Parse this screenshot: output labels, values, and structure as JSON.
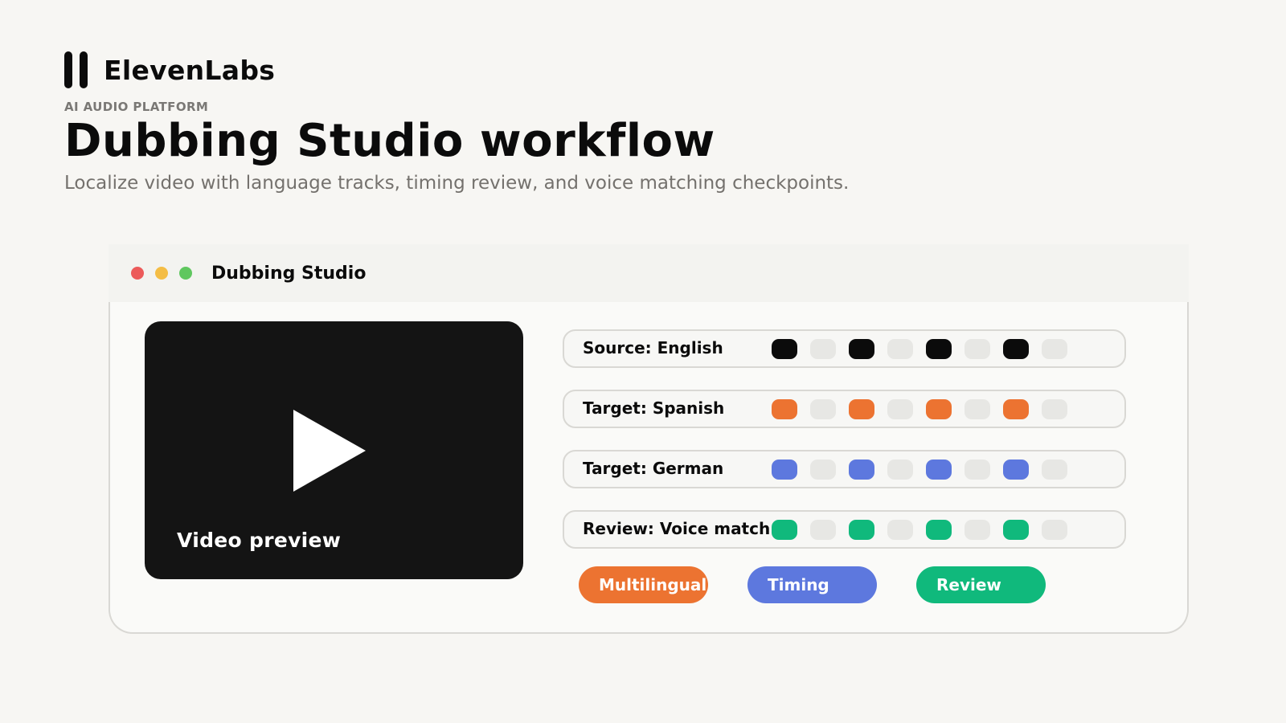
{
  "brand": {
    "name": "ElevenLabs",
    "eyebrow": "AI AUDIO PLATFORM"
  },
  "page": {
    "title": "Dubbing Studio workflow",
    "subtitle": "Localize video with language tracks, timing review, and voice matching checkpoints."
  },
  "colors": {
    "background": "#f7f6f3",
    "close": "#ec5a5a",
    "minimize": "#f4bd45",
    "maximize": "#5fc75f",
    "source": "#0b0b0b",
    "spanish": "#ec7331",
    "german": "#5d78de",
    "review": "#10b97c",
    "empty_block": "#e7e7e4"
  },
  "window": {
    "title": "Dubbing Studio",
    "controls": [
      "close-icon",
      "minimize-icon",
      "maximize-icon"
    ]
  },
  "video": {
    "label": "Video preview",
    "icon": "play-icon"
  },
  "tracks": [
    {
      "label": "Source: English",
      "color": "#0b0b0b",
      "blocks": [
        1,
        0,
        1,
        0,
        1,
        0,
        1,
        0
      ]
    },
    {
      "label": "Target: Spanish",
      "color": "#ec7331",
      "blocks": [
        1,
        0,
        1,
        0,
        1,
        0,
        1,
        0
      ]
    },
    {
      "label": "Target: German",
      "color": "#5d78de",
      "blocks": [
        1,
        0,
        1,
        0,
        1,
        0,
        1,
        0
      ]
    },
    {
      "label": "Review: Voice match",
      "color": "#10b97c",
      "blocks": [
        1,
        0,
        1,
        0,
        1,
        0,
        1,
        0
      ]
    }
  ],
  "tags": [
    {
      "label": "Multilingual",
      "color": "#ec7331"
    },
    {
      "label": "Timing",
      "color": "#5d78de"
    },
    {
      "label": "Review",
      "color": "#10b97c"
    }
  ]
}
